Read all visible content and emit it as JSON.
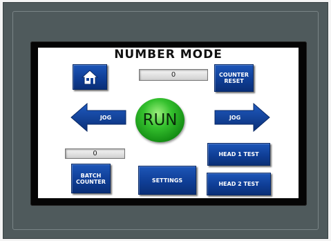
{
  "title": "NUMBER MODE",
  "home_button": {
    "icon": "home-icon"
  },
  "counter_display": {
    "value": "0"
  },
  "counter_reset": {
    "line1": "COUNTER",
    "line2": "RESET"
  },
  "run_button": {
    "label": "RUN"
  },
  "jog_left": {
    "label": "JOG"
  },
  "jog_right": {
    "label": "JOG"
  },
  "batch_display": {
    "value": "0"
  },
  "head1_test": {
    "label": "HEAD 1 TEST"
  },
  "batch_counter": {
    "line1": "BATCH",
    "line2": "COUNTER"
  },
  "settings": {
    "label": "SETTINGS"
  },
  "head2_test": {
    "label": "HEAD 2 TEST"
  },
  "colors": {
    "button_blue": "#0f3e96",
    "run_green": "#35c12e",
    "bezel": "#4f5a5c"
  }
}
